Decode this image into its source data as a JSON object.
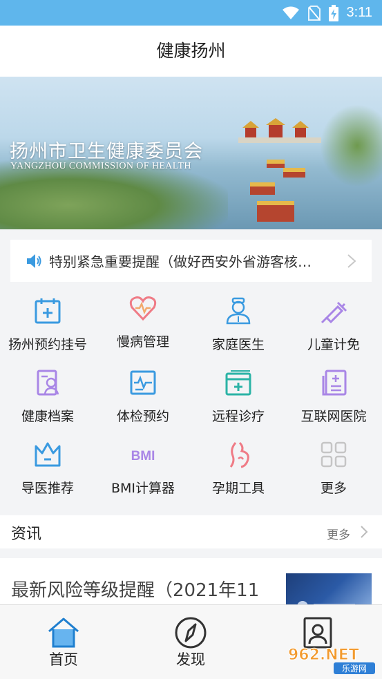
{
  "status_bar": {
    "time": "3:11"
  },
  "header": {
    "title": "健康扬州"
  },
  "banner": {
    "title_cn": "扬州市卫生健康委员会",
    "title_en": "YANGZHOU COMMISSION OF HEALTH"
  },
  "notice": {
    "text": "特别紧急重要提醒（做好西安外省游客核…"
  },
  "services": [
    {
      "label": "扬州预约挂号",
      "icon": "calendar-plus-icon"
    },
    {
      "label": "慢病管理",
      "icon": "heart-pulse-icon"
    },
    {
      "label": "家庭医生",
      "icon": "doctor-icon"
    },
    {
      "label": "儿童计免",
      "icon": "syringe-icon"
    },
    {
      "label": "健康档案",
      "icon": "profile-document-icon"
    },
    {
      "label": "体检预约",
      "icon": "ecg-monitor-icon"
    },
    {
      "label": "远程诊疗",
      "icon": "remote-clinic-icon"
    },
    {
      "label": "互联网医院",
      "icon": "online-hospital-icon"
    },
    {
      "label": "导医推荐",
      "icon": "crown-icon"
    },
    {
      "label": "BMI计算器",
      "icon": "bmi-icon"
    },
    {
      "label": "孕期工具",
      "icon": "pregnancy-icon"
    },
    {
      "label": "更多",
      "icon": "more-grid-icon"
    }
  ],
  "news": {
    "title": "资讯",
    "more_label": "更多",
    "items": [
      {
        "title": "最新风险等级提醒（2021年11"
      }
    ]
  },
  "tabbar": {
    "items": [
      {
        "label": "首页",
        "icon": "home-icon"
      },
      {
        "label": "发现",
        "icon": "compass-icon"
      },
      {
        "label": "",
        "icon": "user-icon"
      }
    ]
  },
  "watermark": {
    "text": "962.NET 乐游网"
  },
  "colors": {
    "status_bar": "#5fb6ec",
    "accent_blue": "#3a9ae0",
    "accent_pink": "#ef7b86",
    "accent_purple": "#a986e6"
  }
}
